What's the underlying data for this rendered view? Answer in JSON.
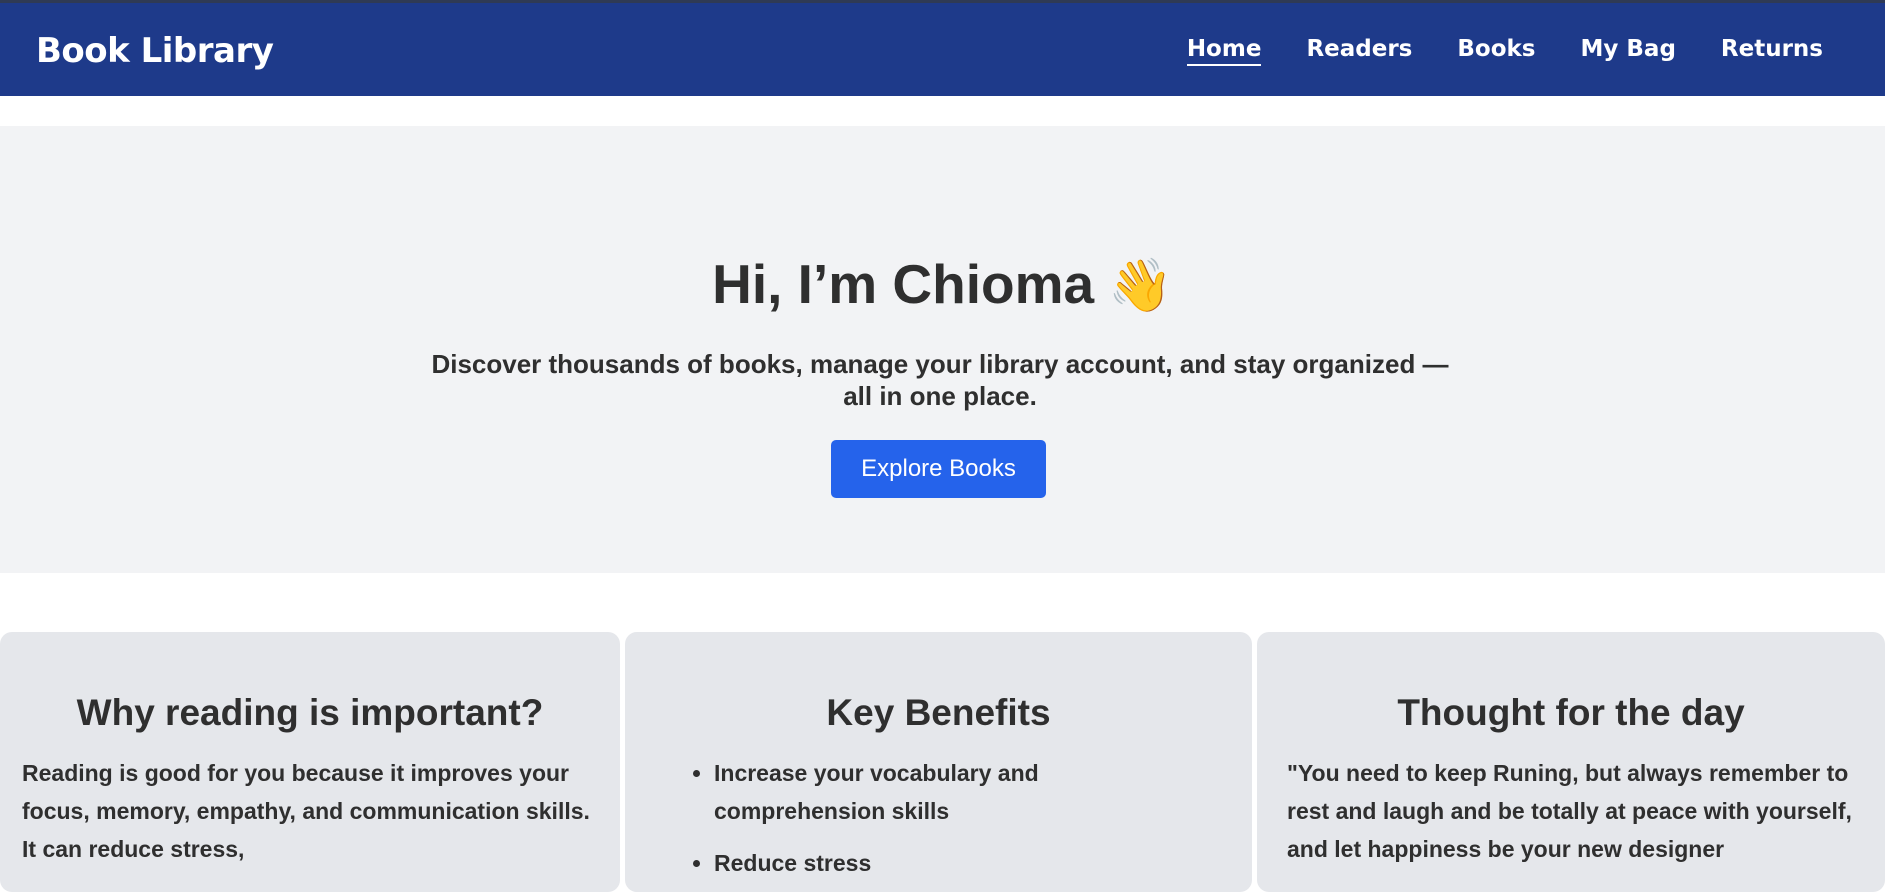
{
  "header": {
    "brand": "Book Library",
    "nav": [
      "Home",
      "Readers",
      "Books",
      "My Bag",
      "Returns"
    ],
    "active_nav": "Home"
  },
  "hero": {
    "greeting": "Hi, I’m Chioma",
    "wave_emoji": "👋",
    "tagline": "Discover thousands of books, manage your library account, and stay organized — all in one place.",
    "cta_label": "Explore Books"
  },
  "cards": [
    {
      "title": "Why reading is important?",
      "body": "Reading is good for you because it improves your focus, memory, empathy, and communication skills. It can reduce stress,"
    },
    {
      "title": "Key Benefits",
      "items": [
        "Increase your vocabulary and comprehension skills",
        "Reduce stress"
      ]
    },
    {
      "title": "Thought for the day",
      "body": "\"You need to keep Runing, but always remember to rest and laugh and be totally at peace with yourself, and let happiness be your new designer"
    }
  ],
  "colors": {
    "navbar": "#1e3a8a",
    "hero_bg": "#f2f3f5",
    "button": "#2563eb",
    "card_bg": "#e5e7eb"
  }
}
